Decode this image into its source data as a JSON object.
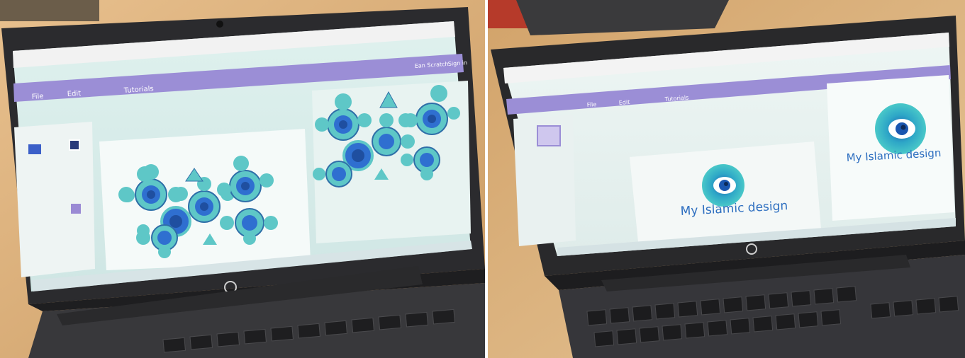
{
  "left_photo": {
    "browser": {
      "user_label": "Ean Scratch",
      "signin_label": "Sign in"
    },
    "editor": {
      "menu_file": "File",
      "menu_edit": "Edit",
      "menu_tutorials": "Tutorials"
    }
  },
  "right_photo": {
    "editor": {
      "menu_file": "File",
      "menu_edit": "Edit",
      "menu_tutorials": "Tutorials"
    },
    "canvas_text": "My Islamic design",
    "stage_text": "My Islamic design"
  },
  "colors": {
    "editor_purple": "#9b8ed6",
    "teal_shape": "#5ec7c7",
    "blue_ring": "#2f6fd0",
    "laptop_body": "#2b2b2e"
  },
  "icons": [
    "hp-logo",
    "webcam"
  ]
}
